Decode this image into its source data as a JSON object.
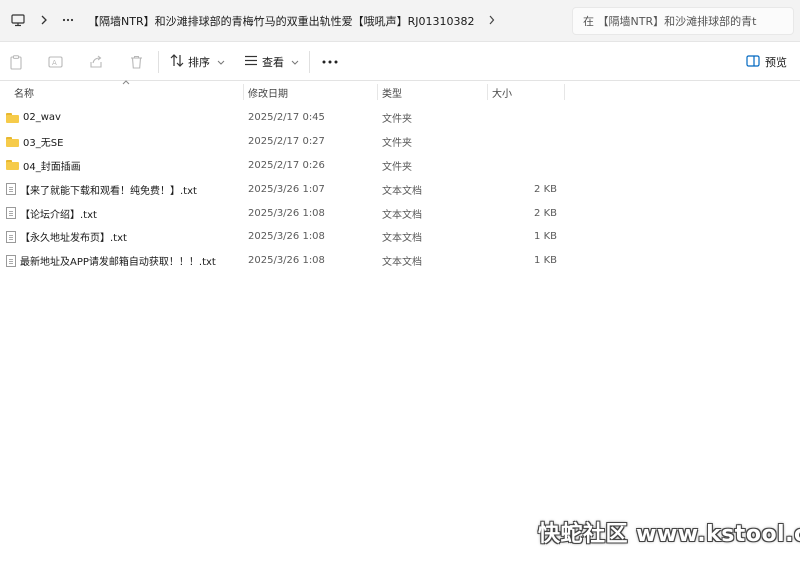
{
  "address_bar": {
    "path": "【隔墙NTR】和沙滩排球部的青梅竹马的双重出轨性爱【哦吼声】RJ01310382",
    "search_placeholder": "在 【隔墙NTR】和沙滩排球部的青t"
  },
  "toolbar": {
    "sort_label": "排序",
    "view_label": "查看",
    "preview_label": "预览"
  },
  "columns": {
    "name": "名称",
    "date": "修改日期",
    "type": "类型",
    "size": "大小"
  },
  "files": [
    {
      "name": "02_wav",
      "date": "2025/2/17 0:45",
      "type": "文件夹",
      "size": "",
      "kind": "folder"
    },
    {
      "name": "03_无SE",
      "date": "2025/2/17 0:27",
      "type": "文件夹",
      "size": "",
      "kind": "folder"
    },
    {
      "name": "04_封面插画",
      "date": "2025/2/17 0:26",
      "type": "文件夹",
      "size": "",
      "kind": "folder"
    },
    {
      "name": "【来了就能下载和观看！纯免费！】.txt",
      "date": "2025/3/26 1:07",
      "type": "文本文档",
      "size": "2 KB",
      "kind": "file"
    },
    {
      "name": "【论坛介绍】.txt",
      "date": "2025/3/26 1:08",
      "type": "文本文档",
      "size": "2 KB",
      "kind": "file"
    },
    {
      "name": "【永久地址发布页】.txt",
      "date": "2025/3/26 1:08",
      "type": "文本文档",
      "size": "1 KB",
      "kind": "file"
    },
    {
      "name": "最新地址及APP请发邮箱自动获取！！！.txt",
      "date": "2025/3/26 1:08",
      "type": "文本文档",
      "size": "1 KB",
      "kind": "file"
    }
  ],
  "watermark": "快蛇社区 www.kstool.cc",
  "colors": {
    "folder": "#f6cb4a",
    "accent": "#0067c0"
  }
}
